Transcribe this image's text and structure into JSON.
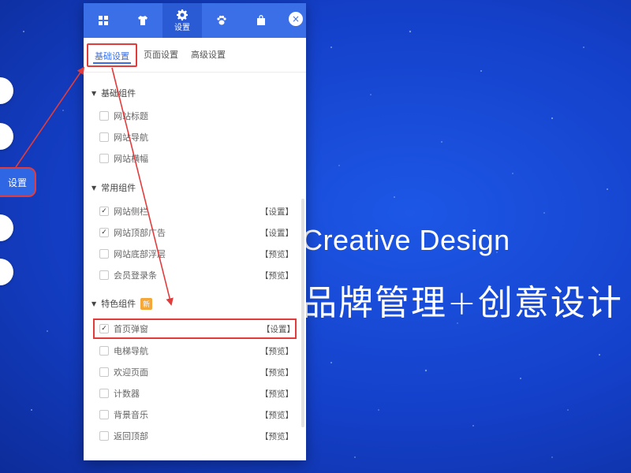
{
  "left_nav": {
    "settings_label": "设置"
  },
  "hero": {
    "english": "Creative Design",
    "chinese": "品牌管理+创意设计"
  },
  "panel": {
    "top_tabs": [
      {
        "icon": "grid-icon",
        "label": ""
      },
      {
        "icon": "shirt-icon",
        "label": ""
      },
      {
        "icon": "gear-icon",
        "label": "设置"
      },
      {
        "icon": "paw-icon",
        "label": ""
      },
      {
        "icon": "bag-icon",
        "label": ""
      }
    ],
    "close_symbol": "×",
    "subtabs": [
      "基础设置",
      "页面设置",
      "高级设置"
    ],
    "sections": {
      "basic": {
        "title": "基础组件",
        "items": [
          {
            "label": "网站标题",
            "checked": false,
            "action": ""
          },
          {
            "label": "网站导航",
            "checked": false,
            "action": ""
          },
          {
            "label": "网站横幅",
            "checked": false,
            "action": ""
          }
        ]
      },
      "common": {
        "title": "常用组件",
        "items": [
          {
            "label": "网站侧栏",
            "checked": true,
            "action": "【设置】"
          },
          {
            "label": "网站顶部广告",
            "checked": true,
            "action": "【设置】"
          },
          {
            "label": "网站底部浮层",
            "checked": false,
            "action": "【预览】"
          },
          {
            "label": "会员登录条",
            "checked": false,
            "action": "【预览】"
          }
        ]
      },
      "special": {
        "title": "特色组件",
        "badge": "新",
        "items": [
          {
            "label": "首页弹窗",
            "checked": true,
            "action": "【设置】"
          },
          {
            "label": "电梯导航",
            "checked": false,
            "action": "【预览】"
          },
          {
            "label": "欢迎页面",
            "checked": false,
            "action": "【预览】"
          },
          {
            "label": "计数器",
            "checked": false,
            "action": "【预览】"
          },
          {
            "label": "背景音乐",
            "checked": false,
            "action": "【预览】"
          },
          {
            "label": "返回顶部",
            "checked": false,
            "action": "【预览】"
          }
        ]
      }
    },
    "checkmark": "✓"
  },
  "colors": {
    "background": "#1440c9",
    "panel_header": "#3b6fe8",
    "annotation": "#e23b3b",
    "badge": "#f4a83a"
  }
}
